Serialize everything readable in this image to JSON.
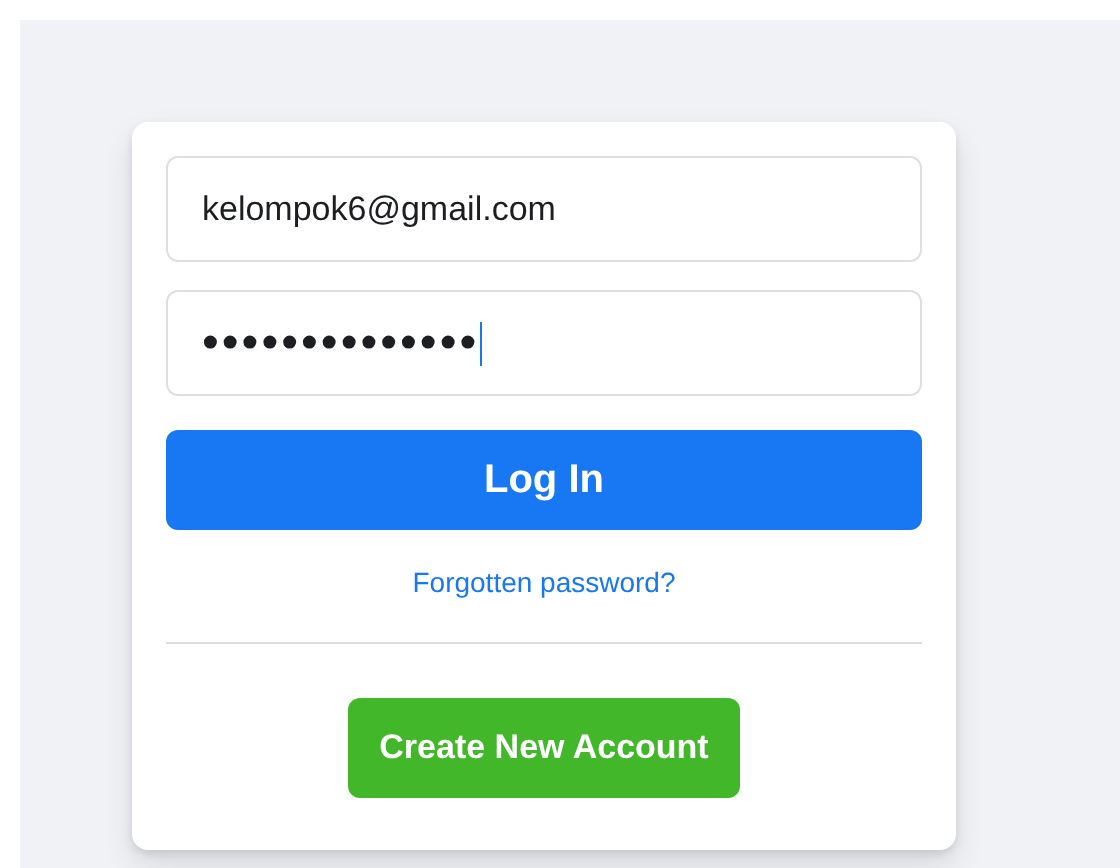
{
  "fields": [
    {
      "kind": "email",
      "value": "kelompok6@gmail.com",
      "focused": false
    },
    {
      "kind": "password",
      "value": "••••••••••••••",
      "focused": true
    }
  ],
  "login_button": "Log In",
  "forgot_link": "Forgotten password?",
  "create_button": "Create New Account"
}
